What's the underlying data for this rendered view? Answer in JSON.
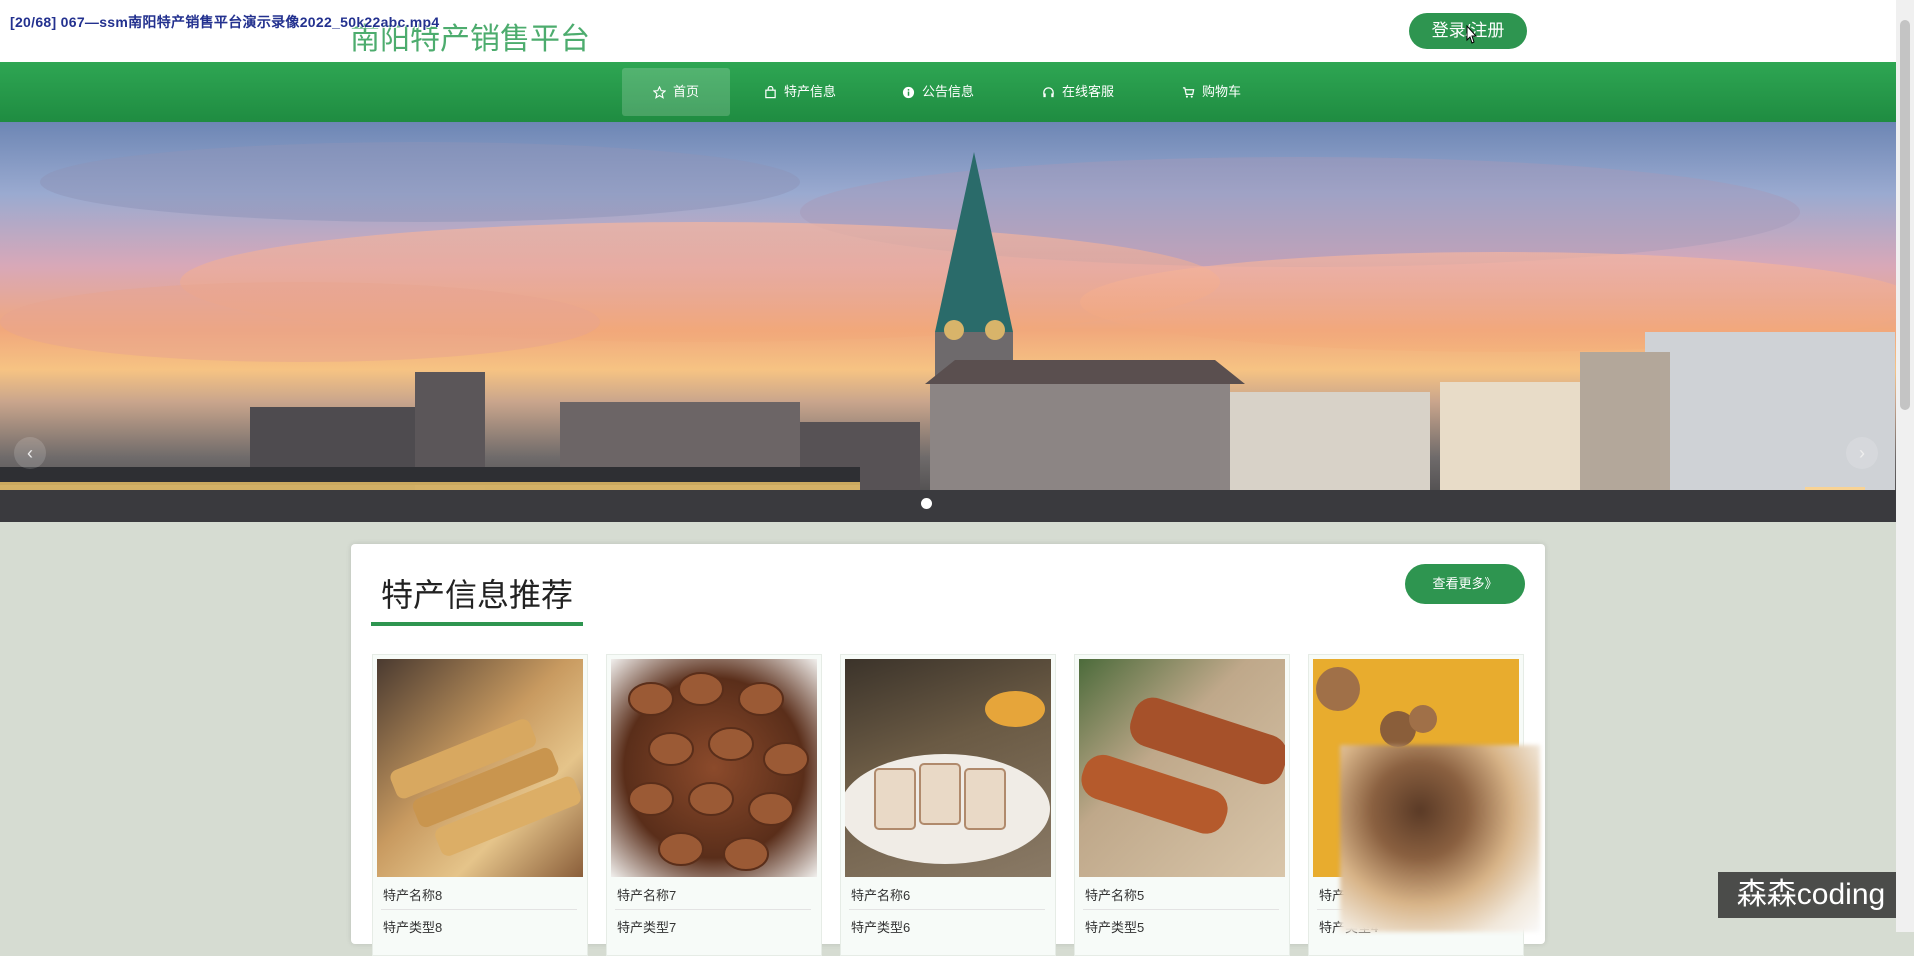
{
  "video": {
    "title": "[20/68] 067—ssm南阳特产销售平台演示录像2022_50k22abc.mp4"
  },
  "header": {
    "logo": "南阳特产销售平台",
    "login_label": "登录/注册"
  },
  "nav": {
    "items": [
      {
        "label": "首页",
        "icon": "star-icon",
        "active": true
      },
      {
        "label": "特产信息",
        "icon": "bag-icon",
        "active": false
      },
      {
        "label": "公告信息",
        "icon": "info-icon",
        "active": false
      },
      {
        "label": "在线客服",
        "icon": "headset-icon",
        "active": false
      },
      {
        "label": "购物车",
        "icon": "cart-icon",
        "active": false
      }
    ]
  },
  "banner": {
    "prev": "‹",
    "next": "›"
  },
  "section": {
    "title": "特产信息推荐",
    "more_label": "查看更多》",
    "products": [
      {
        "name": "特产名称8",
        "type": "特产类型8"
      },
      {
        "name": "特产名称7",
        "type": "特产类型7"
      },
      {
        "name": "特产名称6",
        "type": "特产类型6"
      },
      {
        "name": "特产名称5",
        "type": "特产类型5"
      },
      {
        "name": "特产名称4",
        "type": "特产类型4"
      }
    ]
  },
  "watermark": "森森coding",
  "colors": {
    "primary": "#2e9550",
    "nav_bg": "#269448"
  }
}
